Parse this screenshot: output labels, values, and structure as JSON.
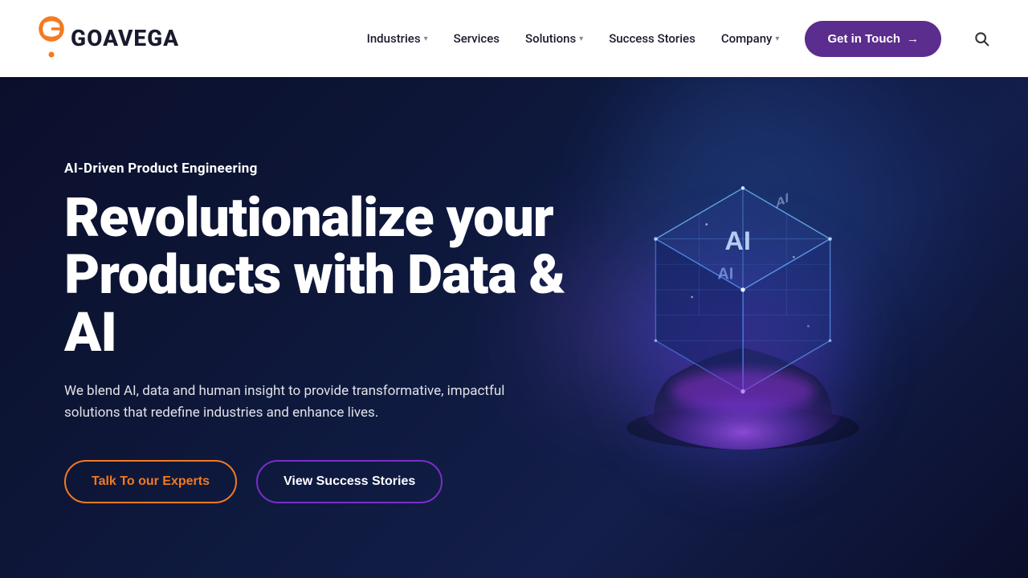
{
  "header": {
    "logo_text": "GOAVEGA",
    "nav_items": [
      {
        "label": "Industries",
        "has_dropdown": true
      },
      {
        "label": "Services",
        "has_dropdown": false
      },
      {
        "label": "Solutions",
        "has_dropdown": true
      },
      {
        "label": "Success Stories",
        "has_dropdown": false
      },
      {
        "label": "Company",
        "has_dropdown": true
      }
    ],
    "cta_label": "Get in Touch",
    "cta_arrow": "→",
    "search_icon": "🔍"
  },
  "hero": {
    "eyebrow": "AI-Driven Product Engineering",
    "title_line1": "Revolutionalize your",
    "title_line2": "Products with Data &",
    "title_line3": "AI",
    "description": "We blend AI, data and human insight to provide transformative, impactful solutions that redefine industries and enhance lives.",
    "btn_primary_label": "Talk To our Experts",
    "btn_secondary_label": "View Success Stories"
  },
  "colors": {
    "bg_dark": "#0a0e2a",
    "accent_orange": "#f47920",
    "accent_purple": "#5b2d8e",
    "white": "#ffffff",
    "nav_text": "#1a1a2e"
  }
}
